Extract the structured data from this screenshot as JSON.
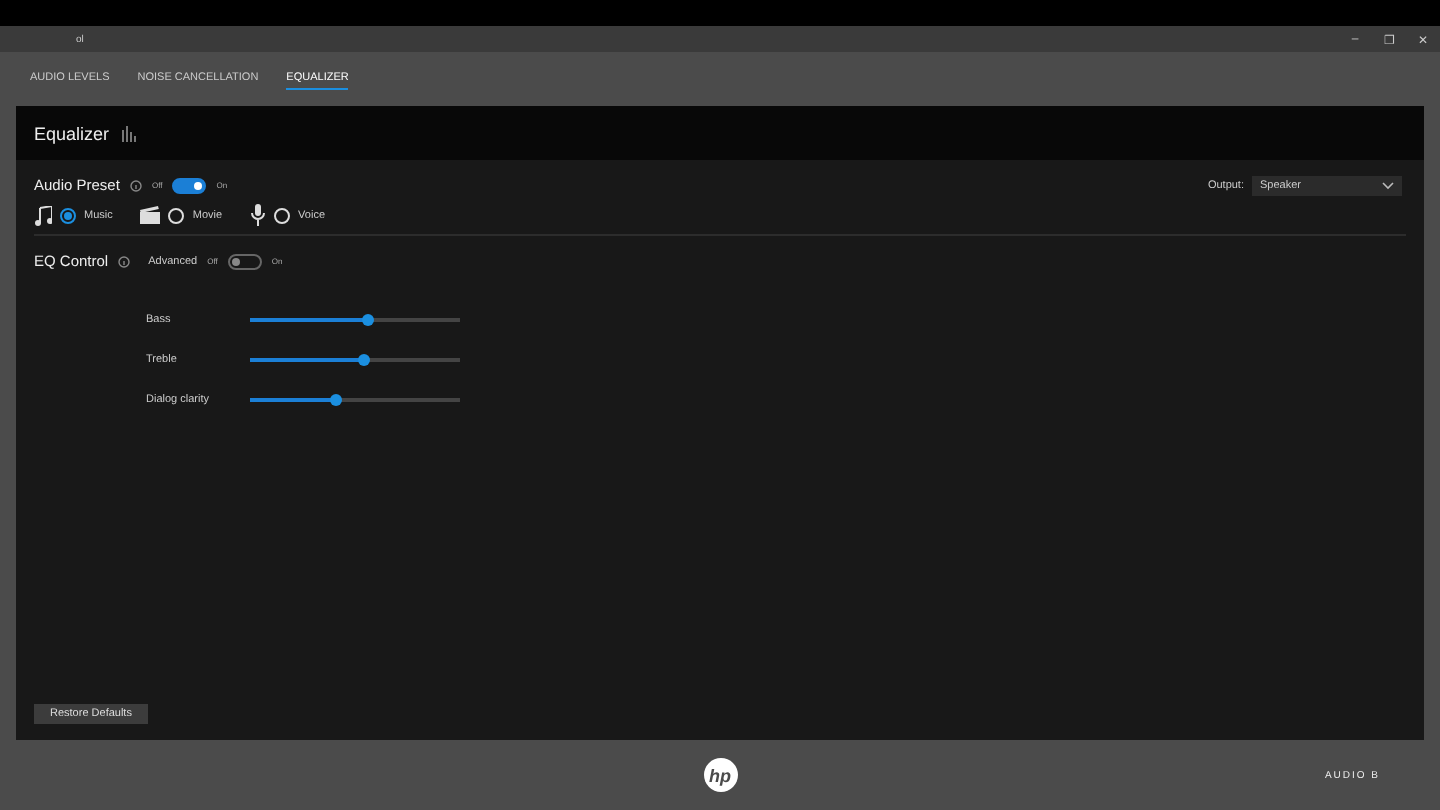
{
  "window": {
    "title": "ol",
    "controls": [
      "–",
      "❐",
      "✕"
    ]
  },
  "tabs": [
    {
      "label": "AUDIO LEVELS",
      "selected": false
    },
    {
      "label": "NOISE CANCELLATION",
      "selected": false
    },
    {
      "label": "EQUALIZER",
      "selected": true
    }
  ],
  "panel": {
    "title": "Equalizer",
    "audio_preset": {
      "label": "Audio Preset",
      "off_label": "Off",
      "on_label": "On",
      "on": true,
      "presets": [
        {
          "kind": "music",
          "label": "Music",
          "selected": true
        },
        {
          "kind": "movie",
          "label": "Movie",
          "selected": false
        },
        {
          "kind": "voice",
          "label": "Voice",
          "selected": false
        }
      ]
    },
    "output": {
      "label": "Output:",
      "value": "Speaker"
    },
    "eq_control": {
      "label": "EQ Control",
      "advanced_label": "Advanced",
      "off_label": "Off",
      "on_label": "On",
      "on": false
    },
    "sliders": [
      {
        "name": "Bass",
        "level": 0.56
      },
      {
        "name": "Treble",
        "level": 0.54
      },
      {
        "name": "Dialog clarity",
        "level": 0.41
      }
    ],
    "restore_button": "Restore Defaults"
  },
  "footer": {
    "logo": "hp",
    "brand": "AUDIO B"
  }
}
